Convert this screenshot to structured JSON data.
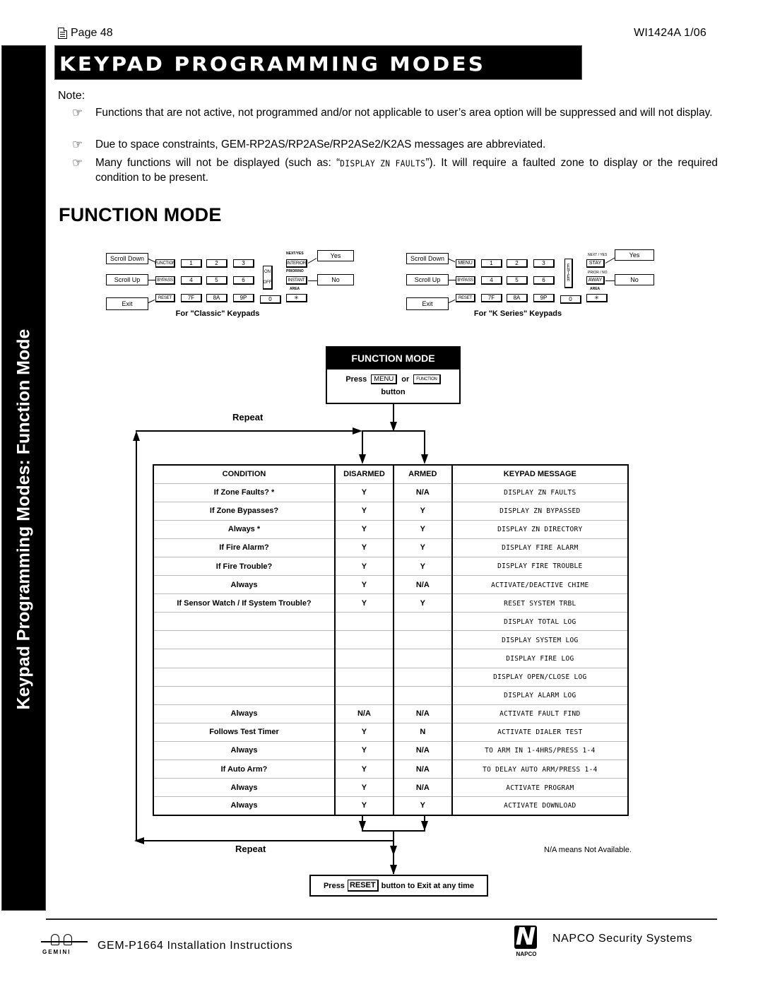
{
  "header": {
    "page_label": "Page 48",
    "doc_id": "WI1424A  1/06",
    "title": "KEYPAD PROGRAMMING MODES",
    "sidebar_text": "Keypad Programming Modes: Function Mode"
  },
  "notes": {
    "heading": "Note:",
    "bullet_icon": "pointing-hand-icon",
    "items": [
      "Functions that are not active, not programmed and/or not applicable to user’s area option will be suppressed and will not display.",
      "Due to space constraints, GEM-RP2AS/RP2ASe/RP2ASe2/K2AS messages are abbreviated.",
      {
        "before": "Many functions will not be displayed (such as: “",
        "lcd": "DISPLAY ZN FAULTS",
        "after": "”).  It will require a faulted zone to display or the required condition to be present."
      }
    ]
  },
  "section_title": "FUNCTION MODE",
  "keypads": [
    {
      "caption": "For \"Classic\" Keypads",
      "callouts": {
        "scroll_down": "Scroll Down",
        "scroll_up": "Scroll Up",
        "exit": "Exit",
        "yes": "Yes",
        "no": "No"
      },
      "keys": {
        "function": "FUNCTION",
        "bypass": "BYPASS",
        "reset": "RESET",
        "k1": "1",
        "k2": "2",
        "k3": "3",
        "k4": "4",
        "k5": "5",
        "k6": "6",
        "k7": "7F",
        "k8": "8A",
        "k9": "9P",
        "k0": "0",
        "power_on": "ON",
        "power_off": "OFF",
        "next": "INTERIOR",
        "prior": "INSTANT",
        "area": "✳"
      },
      "key_labels": {
        "next": "NEXT/YES",
        "prior": "PRIOR/NO",
        "area": "AREA"
      }
    },
    {
      "caption": "For \"K Series\" Keypads",
      "callouts": {
        "scroll_down": "Scroll Down",
        "scroll_up": "Scroll Up",
        "exit": "Exit",
        "yes": "Yes",
        "no": "No"
      },
      "keys": {
        "function": "MENU",
        "bypass": "BYPASS",
        "reset": "RESET",
        "k1": "1",
        "k2": "2",
        "k3": "3",
        "k4": "4",
        "k5": "5",
        "k6": "6",
        "k7": "7F",
        "k8": "8A",
        "k9": "9P",
        "k0": "0",
        "enter": "ENTER",
        "next": "STAY",
        "prior": "AWAY",
        "area": "✳"
      },
      "key_labels": {
        "next": "NEXT / YES",
        "prior": "PRIOR / NO",
        "area": "AREA"
      }
    }
  ],
  "flow": {
    "box_title": "FUNCTION MODE",
    "press": "Press",
    "menu_key": "MENU",
    "or": "or",
    "function_key": "FUNCTION",
    "button": "button",
    "repeat_top": "Repeat",
    "repeat_bottom": "Repeat",
    "na_note": "N/A means Not Available.",
    "exit_press": "Press",
    "exit_key": "RESET",
    "exit_text": "button to Exit at any time"
  },
  "table": {
    "headers": [
      "CONDITION",
      "DISARMED",
      "ARMED",
      "KEYPAD MESSAGE"
    ],
    "rows": [
      [
        "If Zone Faults? *",
        "Y",
        "N/A",
        "DISPLAY ZN FAULTS"
      ],
      [
        "If Zone Bypasses?",
        "Y",
        "Y",
        "DISPLAY ZN BYPASSED"
      ],
      [
        "Always *",
        "Y",
        "Y",
        "DISPLAY ZN DIRECTORY"
      ],
      [
        "If Fire Alarm?",
        "Y",
        "Y",
        "DISPLAY FIRE ALARM"
      ],
      [
        "If Fire Trouble?",
        "Y",
        "Y",
        "DISPLAY FIRE TROUBLE"
      ],
      [
        "Always",
        "Y",
        "N/A",
        "ACTIVATE/DEACTIVE CHIME"
      ],
      [
        "If Sensor Watch / If System Trouble?",
        "Y",
        "Y",
        "RESET SYSTEM TRBL"
      ],
      [
        "",
        "",
        "",
        "DISPLAY TOTAL LOG"
      ],
      [
        "",
        "",
        "",
        "DISPLAY SYSTEM LOG"
      ],
      [
        "",
        "",
        "",
        "DISPLAY FIRE LOG"
      ],
      [
        "",
        "",
        "",
        "DISPLAY OPEN/CLOSE LOG"
      ],
      [
        "",
        "",
        "",
        "DISPLAY ALARM LOG"
      ],
      [
        "Always",
        "N/A",
        "N/A",
        "ACTIVATE FAULT FIND"
      ],
      [
        "Follows Test Timer",
        "Y",
        "N",
        "ACTIVATE DIALER TEST"
      ],
      [
        "Always",
        "Y",
        "N/A",
        "TO ARM IN 1-4HRS/PRESS 1-4"
      ],
      [
        "If Auto Arm?",
        "Y",
        "N/A",
        "TO DELAY AUTO ARM/PRESS 1-4"
      ],
      [
        "Always",
        "Y",
        "N/A",
        "ACTIVATE PROGRAM"
      ],
      [
        "Always",
        "Y",
        "Y",
        "ACTIVATE DOWNLOAD"
      ]
    ]
  },
  "footer": {
    "left_logo_word": "GEMINI",
    "left_text": "GEM-P1664 Installation Instructions",
    "right_logo_word": "NAPCO",
    "right_text": "NAPCO Security Systems"
  }
}
